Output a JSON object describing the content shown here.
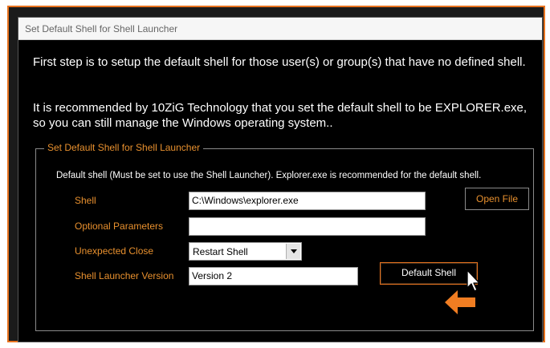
{
  "dialog": {
    "title": "Set Default Shell for Shell Launcher"
  },
  "intro": {
    "line1": "First step is to setup the default shell for those user(s) or group(s) that have no defined shell.",
    "line2": "It is recommended by 10ZiG Technology that you set the default shell to be EXPLORER.exe, so you can still manage the Windows operating system.."
  },
  "group": {
    "title": "Set Default Shell for Shell Launcher",
    "description": "Default shell (Must be set to use the Shell Launcher). Explorer.exe is recommended for the default shell."
  },
  "fields": {
    "shell_label": "Shell",
    "shell_value": "C:\\Windows\\explorer.exe",
    "optional_params_label": "Optional Parameters",
    "optional_params_value": "",
    "unexpected_close_label": "Unexpected Close",
    "unexpected_close_value": "Restart Shell",
    "version_label": "Shell Launcher Version",
    "version_value": "Version 2"
  },
  "buttons": {
    "open_file": "Open File",
    "default_shell": "Default Shell"
  },
  "colors": {
    "accent": "#e8902e",
    "frame_border": "#e8731f",
    "background": "#000000"
  },
  "icons": {
    "pointer": "mouse-pointer-icon",
    "arrow": "orange-left-arrow-icon"
  }
}
